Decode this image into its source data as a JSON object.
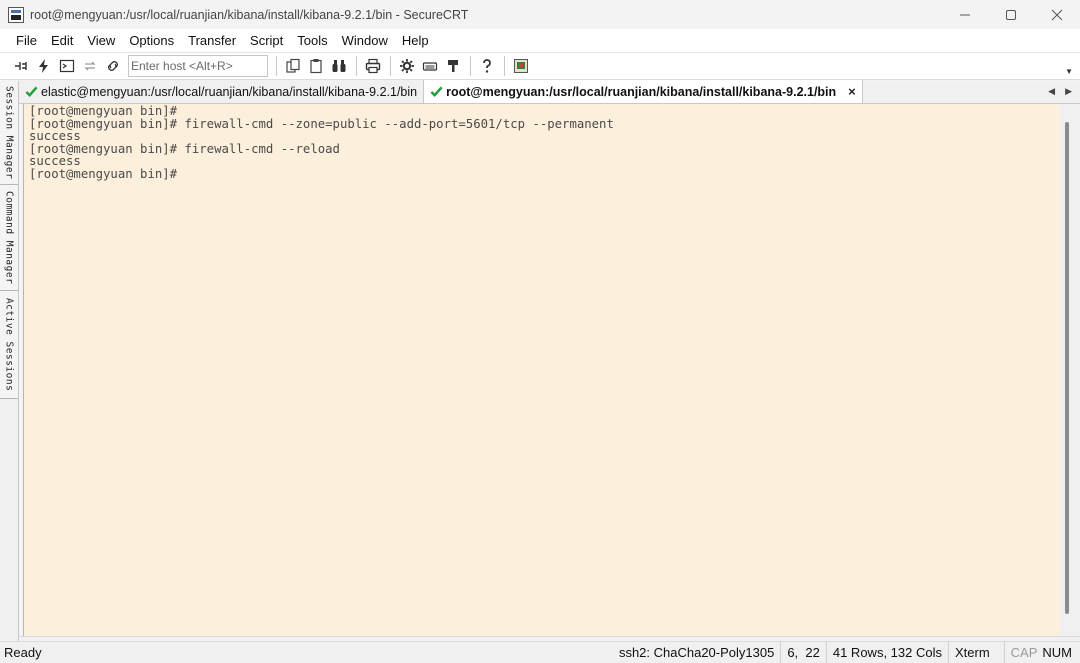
{
  "window": {
    "title": "root@mengyuan:/usr/local/ruanjian/kibana/install/kibana-9.2.1/bin - SecureCRT"
  },
  "menu": [
    "File",
    "Edit",
    "View",
    "Options",
    "Transfer",
    "Script",
    "Tools",
    "Window",
    "Help"
  ],
  "toolbar": {
    "host_placeholder": "Enter host <Alt+R>"
  },
  "side_panel": {
    "tabs": [
      "Session Manager",
      "Command Manager",
      "Active Sessions"
    ]
  },
  "tabs": [
    {
      "label": "elastic@mengyuan:/usr/local/ruanjian/kibana/install/kibana-9.2.1/bin",
      "active": false
    },
    {
      "label": "root@mengyuan:/usr/local/ruanjian/kibana/install/kibana-9.2.1/bin",
      "active": true,
      "close": "×"
    }
  ],
  "terminal": {
    "lines": [
      "[root@mengyuan bin]#",
      "[root@mengyuan bin]# firewall-cmd --zone=public --add-port=5601/tcp --permanent",
      "success",
      "[root@mengyuan bin]# firewall-cmd --reload",
      "success",
      "[root@mengyuan bin]#"
    ]
  },
  "status": {
    "ready": "Ready",
    "cipher": "ssh2: ChaCha20-Poly1305",
    "cursor": "6,  22",
    "size": "41 Rows, 132 Cols",
    "terminal_type": "Xterm",
    "cap": "CAP",
    "num": "NUM"
  },
  "colors": {
    "terminal_bg": "#fcf0dc",
    "terminal_fg": "#4a4a4a",
    "check_green": "#1f9e3a"
  }
}
